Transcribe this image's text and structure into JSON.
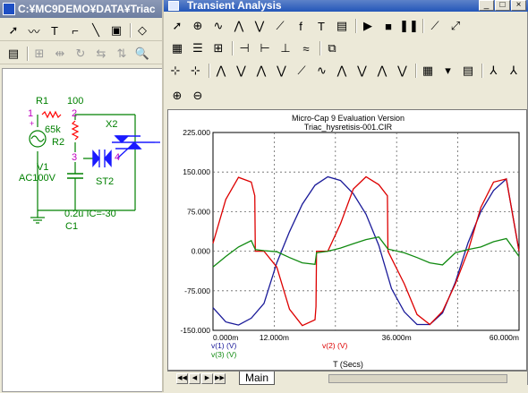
{
  "back_window": {
    "title": "C:¥MC9DEMO¥DATA¥Triac",
    "toolbar1": [
      {
        "icon": "arrow-select-icon",
        "glyph": "➚"
      },
      {
        "icon": "wire-icon",
        "glyph": "〰"
      },
      {
        "icon": "text-icon",
        "glyph": "T"
      },
      {
        "icon": "line-icon",
        "glyph": "⌐"
      },
      {
        "icon": "diagonal-icon",
        "glyph": "╲"
      },
      {
        "icon": "component-icon",
        "glyph": "▣"
      },
      {
        "icon": "shape-icon",
        "glyph": "◇"
      }
    ],
    "toolbar2": [
      {
        "icon": "properties-icon",
        "glyph": "▤",
        "disabled": false
      },
      {
        "icon": "grid-icon",
        "glyph": "⊞",
        "disabled": true
      },
      {
        "icon": "flip-icon",
        "glyph": "⇹",
        "disabled": true
      },
      {
        "icon": "rotate-icon",
        "glyph": "↻",
        "disabled": true
      },
      {
        "icon": "mirror-icon",
        "glyph": "⇆",
        "disabled": true
      },
      {
        "icon": "step-icon",
        "glyph": "⇅",
        "disabled": true
      },
      {
        "icon": "find-icon",
        "glyph": "🔍",
        "disabled": false
      }
    ]
  },
  "schematic": {
    "labels": {
      "r1": "R1",
      "r1_value": "100",
      "r2": "R2",
      "r2_value": "65k",
      "v1": "V1",
      "v1_value": "AC100V",
      "c1": "C1",
      "c1_value": "0.2u IC=-30",
      "x2": "X2",
      "st2": "ST2"
    },
    "nodes": [
      "1",
      "2",
      "3",
      "4"
    ],
    "colors": {
      "node": "#c000c0",
      "wire": "#008000",
      "label": "#008000",
      "component": "#1a1aff",
      "resistor": "#ff0000"
    }
  },
  "ta_window": {
    "title": "Transient Analysis",
    "controls": {
      "minimize": "_",
      "maximize": "□",
      "close": "×"
    },
    "toolbar1": [
      {
        "icon": "select-arrow-icon",
        "glyph": "➚"
      },
      {
        "icon": "scale-icon",
        "glyph": "⊕"
      },
      {
        "icon": "waveform-icon",
        "glyph": "∿"
      },
      {
        "icon": "peak-icon",
        "glyph": "⋀"
      },
      {
        "icon": "valley-icon",
        "glyph": "⋁"
      },
      {
        "icon": "slope-icon",
        "glyph": "⟋"
      },
      {
        "icon": "function-icon",
        "glyph": "f"
      },
      {
        "icon": "text-icon",
        "glyph": "T"
      },
      {
        "icon": "properties-icon",
        "glyph": "▤"
      },
      {
        "icon": "run-icon",
        "glyph": "▶"
      },
      {
        "icon": "stop-icon",
        "glyph": "■"
      },
      {
        "icon": "pause-icon",
        "glyph": "❚❚"
      },
      {
        "icon": "tangent-icon",
        "glyph": "⟋"
      },
      {
        "icon": "line-plot-icon",
        "glyph": "⤢"
      }
    ],
    "toolbar2": [
      {
        "icon": "table-icon",
        "glyph": "▦"
      },
      {
        "icon": "list-icon",
        "glyph": "☰"
      },
      {
        "icon": "grid-lines-icon",
        "glyph": "⊞"
      },
      {
        "icon": "cursor-left-icon",
        "glyph": "⊣"
      },
      {
        "icon": "cursor-right-icon",
        "glyph": "⊢"
      },
      {
        "icon": "cursor-both-icon",
        "glyph": "⊥"
      },
      {
        "icon": "cursor-slope-icon",
        "glyph": "≈"
      },
      {
        "icon": "plot-options-icon",
        "glyph": "⧉"
      }
    ],
    "toolbar3": [
      {
        "icon": "cursor-mode-icon",
        "glyph": "⊹"
      },
      {
        "icon": "cursor-mode2-icon",
        "glyph": "⊹"
      },
      {
        "icon": "next-peak-icon",
        "glyph": "⋀"
      },
      {
        "icon": "next-valley-icon",
        "glyph": "⋁"
      },
      {
        "icon": "next-high-icon",
        "glyph": "⋀"
      },
      {
        "icon": "next-low-icon",
        "glyph": "⋁"
      },
      {
        "icon": "next-slope-icon",
        "glyph": "⟋"
      },
      {
        "icon": "next-inflection-icon",
        "glyph": "∿"
      },
      {
        "icon": "next-max-icon",
        "glyph": "⋀"
      },
      {
        "icon": "next-min-icon",
        "glyph": "⋁"
      },
      {
        "icon": "next-level-icon",
        "glyph": "⋀"
      },
      {
        "icon": "next-edge-icon",
        "glyph": "⋁"
      },
      {
        "icon": "chart-settings-icon",
        "glyph": "▦"
      },
      {
        "icon": "dropdown-icon",
        "glyph": "▾"
      },
      {
        "icon": "table-view-icon",
        "glyph": "▤"
      },
      {
        "icon": "tag-x-icon",
        "glyph": "⅄"
      },
      {
        "icon": "tag-y-icon",
        "glyph": "⅄"
      }
    ],
    "toolbar4": [
      {
        "icon": "zoom-in-icon",
        "glyph": "⊕"
      },
      {
        "icon": "zoom-out-icon",
        "glyph": "⊖"
      }
    ],
    "tab": "Main"
  },
  "chart_data": {
    "type": "line",
    "title": "Micro-Cap 9 Evaluation Version",
    "subtitle": "Triac_hysretisis-001.CIR",
    "xlabel": "T (Secs)",
    "xlim": [
      0,
      60
    ],
    "ylim": [
      -150,
      225
    ],
    "x_ticks": [
      "0.000m",
      "12.000m",
      "36.000m",
      "60.000m"
    ],
    "x_tick_values": [
      0,
      12,
      36,
      60
    ],
    "y_ticks": [
      "225.000",
      "150.000",
      "75.000",
      "0.000",
      "-75.000",
      "-150.000"
    ],
    "y_tick_values": [
      225,
      150,
      75,
      0,
      -75,
      -150
    ],
    "grid": true,
    "legend_placement": "bottom-left",
    "series": [
      {
        "name": "v(1) (V)",
        "color": "#1a1a99",
        "x": [
          0,
          2.5,
          5,
          7.5,
          10,
          12.5,
          15,
          17.5,
          20,
          22.5,
          25,
          27.5,
          30,
          32.5,
          35,
          37.5,
          40,
          42.5,
          45,
          47.5,
          50,
          52.5,
          55,
          57.5,
          60
        ],
        "values": [
          -107,
          -134,
          -140,
          -127,
          -99,
          -22,
          37,
          89,
          125,
          141,
          134,
          109,
          70,
          11,
          -71,
          -115,
          -139,
          -139,
          -117,
          -59,
          16,
          75,
          115,
          137,
          0
        ]
      },
      {
        "name": "v(2) (V)",
        "color": "#dd0000",
        "x": [
          0,
          2.5,
          5,
          7.5,
          8.2,
          8.3,
          10,
          12.5,
          15,
          17.5,
          20,
          20.2,
          20.3,
          22.5,
          25,
          27.5,
          30,
          32.5,
          34.2,
          34.3,
          37.5,
          40,
          42.5,
          45,
          47.5,
          50,
          52.5,
          55,
          57.5,
          60
        ],
        "values": [
          15,
          98,
          140,
          131,
          105,
          0,
          0,
          -30,
          -110,
          -141,
          -130,
          -105,
          0,
          0,
          52,
          118,
          141,
          126,
          105,
          0,
          -62,
          -120,
          -139,
          -114,
          -62,
          0,
          83,
          131,
          137,
          0
        ]
      },
      {
        "name": "v(3) (V)",
        "color": "#108a10",
        "x": [
          0,
          2.5,
          5,
          7.5,
          8.3,
          10,
          12.5,
          15,
          17.5,
          20,
          20.3,
          22.5,
          25,
          27.5,
          30,
          32.5,
          34.3,
          37.5,
          40,
          42.5,
          45,
          47.5,
          50,
          52.5,
          55,
          57.5,
          60
        ],
        "values": [
          -30,
          -10,
          8,
          20,
          3,
          1,
          -1,
          -12,
          -22,
          -25,
          -3,
          0,
          6,
          14,
          22,
          27,
          4,
          -3,
          -12,
          -22,
          -26,
          -3,
          3,
          8,
          18,
          24,
          -10
        ]
      }
    ]
  }
}
